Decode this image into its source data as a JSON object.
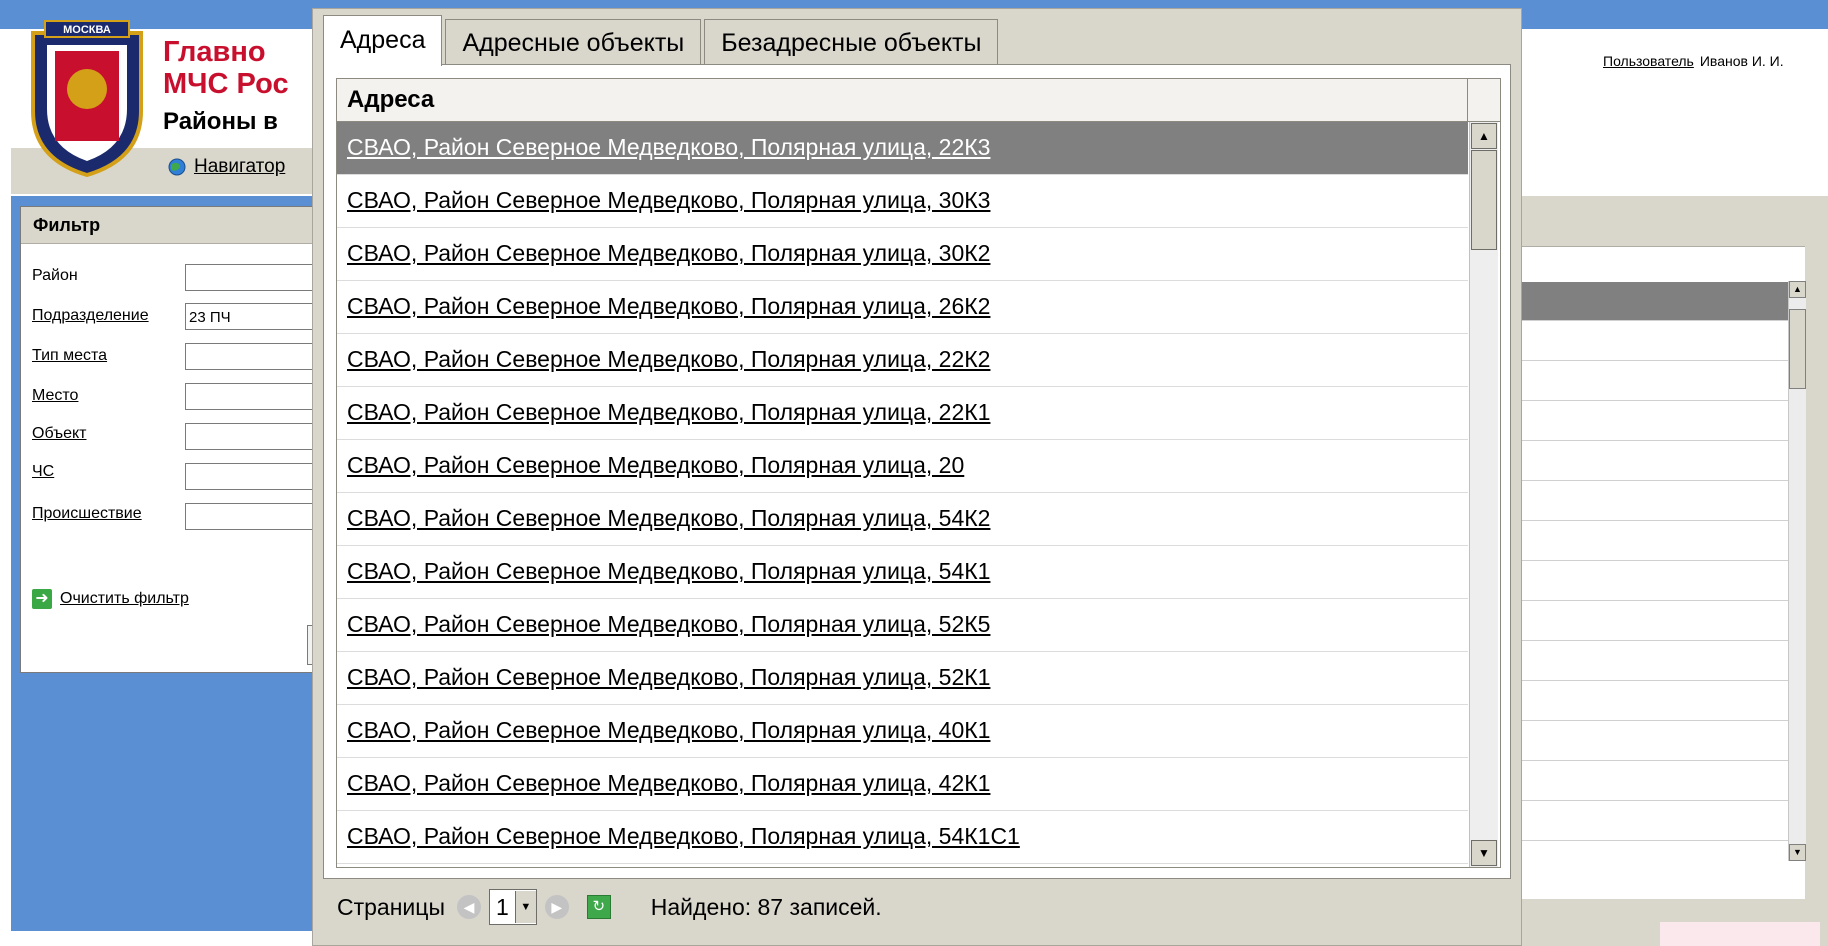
{
  "header": {
    "brand_line1": "Главно",
    "brand_line2": "МЧС Рос",
    "brand_line3": "Районы в",
    "emblem_text": "МОСКВА",
    "navigator_label": "Навигатор",
    "user_link": "Пользователь",
    "user_name": "Иванов И. И."
  },
  "filter": {
    "title": "Фильтр",
    "fields": [
      {
        "label": "Район",
        "value": ""
      },
      {
        "label": "Подразделение",
        "value": "23 ПЧ"
      },
      {
        "label": "Тип места",
        "value": ""
      },
      {
        "label": "Место",
        "value": ""
      },
      {
        "label": "Объект",
        "value": ""
      },
      {
        "label": "ЧС",
        "value": ""
      },
      {
        "label": "Происшествие",
        "value": ""
      }
    ],
    "clear_label": "Очистить фильтр"
  },
  "dialog": {
    "tabs": [
      "Адреса",
      "Адресные объекты",
      "Безадресные объекты"
    ],
    "active_tab": "Адреса",
    "grid_header": "Адреса",
    "rows": [
      "СВАО, Район Северное Медведково, Полярная улица, 22К3",
      "СВАО, Район Северное Медведково, Полярная улица, 30К3",
      "СВАО, Район Северное Медведково, Полярная улица, 30К2",
      "СВАО, Район Северное Медведково, Полярная улица, 26К2",
      "СВАО, Район Северное Медведково, Полярная улица, 22К2",
      "СВАО, Район Северное Медведково, Полярная улица, 22К1",
      "СВАО, Район Северное Медведково, Полярная улица, 20",
      "СВАО, Район Северное Медведково, Полярная улица, 54К2",
      "СВАО, Район Северное Медведково, Полярная улица, 54К1",
      "СВАО, Район Северное Медведково, Полярная улица, 52К5",
      "СВАО, Район Северное Медведково, Полярная улица, 52К1",
      "СВАО, Район Северное Медведково, Полярная улица, 40К1",
      "СВАО, Район Северное Медведково, Полярная улица, 42К1",
      "СВАО, Район Северное Медведково, Полярная улица, 54К1С1"
    ],
    "selected_index": 0,
    "pager": {
      "label": "Страницы",
      "page": "1",
      "found": "Найдено: 87 записей."
    }
  },
  "icons": {
    "prev": "arrow-left-circle-icon",
    "next": "arrow-right-circle-icon",
    "refresh": "refresh-icon",
    "clear": "green-arrow-icon",
    "navigator": "globe-icon"
  },
  "colors": {
    "brand_red": "#c8102e",
    "band_blue": "#5b8fd4",
    "selection_gray": "#808080",
    "panel_beige": "#d9d6cc"
  }
}
